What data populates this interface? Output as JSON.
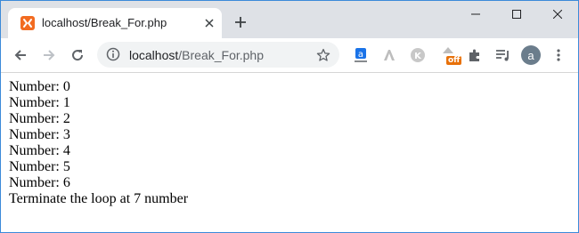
{
  "browser": {
    "tab": {
      "title": "localhost/Break_For.php",
      "favicon": "xampp-icon"
    },
    "address_bar": {
      "host": "localhost",
      "path": "/Break_For.php"
    },
    "extensions": {
      "badge_text": "off"
    },
    "profile": {
      "initial": "a"
    },
    "accent_color": "#3c8ad9"
  },
  "page": {
    "lines": [
      "Number: 0",
      "Number: 1",
      "Number: 2",
      "Number: 3",
      "Number: 4",
      "Number: 5",
      "Number: 6",
      "Terminate the loop at 7 number"
    ]
  }
}
